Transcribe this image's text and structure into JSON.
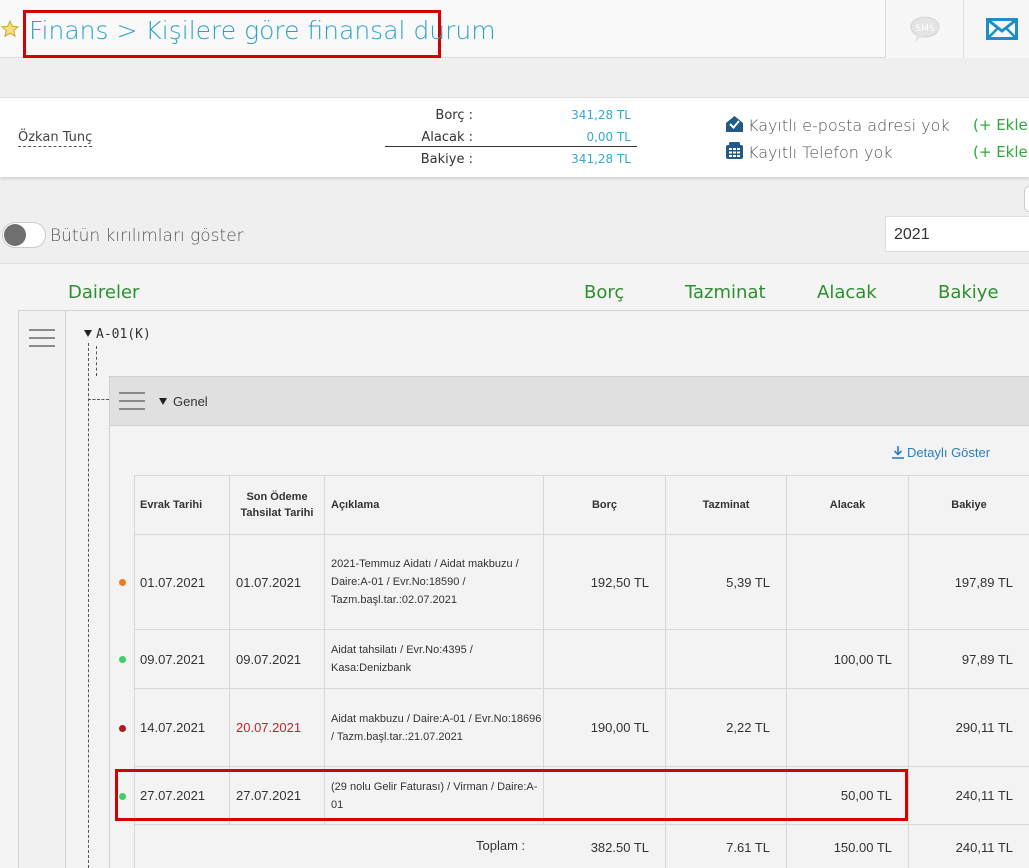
{
  "header": {
    "breadcrumb": "Finans > Kişilere göre finansal durum",
    "sms_label": "SMS"
  },
  "summary": {
    "person_name": "Özkan Tunç",
    "rows": [
      {
        "label": "Borç :",
        "value": "341,28 TL"
      },
      {
        "label": "Alacak :",
        "value": "0,00 TL"
      },
      {
        "label": "Bakiye :",
        "value": "341,28 TL"
      }
    ],
    "email_text": "Kayıtlı e-posta adresi yok",
    "phone_text": "Kayıtlı Telefon yok",
    "add_email": "(+ Ekle)",
    "add_phone": "(+ Ekle)"
  },
  "filters": {
    "toggle_label": "Bütün kırılımları göster",
    "toggle_on": false,
    "year": "2021"
  },
  "columns": {
    "units": "Daireler",
    "debt": "Borç",
    "penalty": "Tazminat",
    "credit": "Alacak",
    "balance": "Bakiye"
  },
  "unit": {
    "name": "A-01(K)",
    "group": "Genel",
    "details_link": "Detaylı Göster"
  },
  "table": {
    "headers": {
      "doc_date": "Evrak Tarihi",
      "last_date_1": "Son Ödeme",
      "last_date_2": "Tahsilat Tarihi",
      "desc": "Açıklama",
      "debt": "Borç",
      "penalty": "Tazminat",
      "credit": "Alacak",
      "balance": "Bakiye"
    },
    "rows": [
      {
        "status_color": "#f07b1f",
        "doc_date": "01.07.2021",
        "last_date": "01.07.2021",
        "last_date_overdue": false,
        "desc": "2021-Temmuz Aidatı / Aidat makbuzu / Daire:A-01 / Evr.No:18590 / Tazm.başl.tar.:02.07.2021",
        "debt": "192,50 TL",
        "penalty": "5,39 TL",
        "credit": "",
        "balance": "197,89 TL"
      },
      {
        "status_color": "#3ecf6a",
        "doc_date": "09.07.2021",
        "last_date": "09.07.2021",
        "last_date_overdue": false,
        "desc": "Aidat tahsilatı / Evr.No:4395 / Kasa:Denizbank",
        "debt": "",
        "penalty": "",
        "credit": "100,00 TL",
        "balance": "97,89 TL"
      },
      {
        "status_color": "#b3161c",
        "doc_date": "14.07.2021",
        "last_date": "20.07.2021",
        "last_date_overdue": true,
        "desc": "Aidat makbuzu / Daire:A-01 / Evr.No:18696 / Tazm.başl.tar.:21.07.2021",
        "debt": "190,00 TL",
        "penalty": "2,22 TL",
        "credit": "",
        "balance": "290,11 TL"
      },
      {
        "status_color": "#3ecf6a",
        "doc_date": "27.07.2021",
        "last_date": "27.07.2021",
        "last_date_overdue": false,
        "desc": "(29 nolu Gelir Faturası) / Virman / Daire:A-01",
        "debt": "",
        "penalty": "",
        "credit": "50,00 TL",
        "balance": "240,11 TL"
      }
    ],
    "totals": {
      "label": "Toplam :",
      "debt": "382.50 TL",
      "penalty": "7.61 TL",
      "credit": "150.00 TL",
      "balance": "240,11 TL"
    }
  },
  "colors": {
    "accent_blue": "#29a3c9",
    "value_blue": "#35a8d4",
    "green": "#2e8f2e",
    "highlight_red": "#d60000"
  }
}
